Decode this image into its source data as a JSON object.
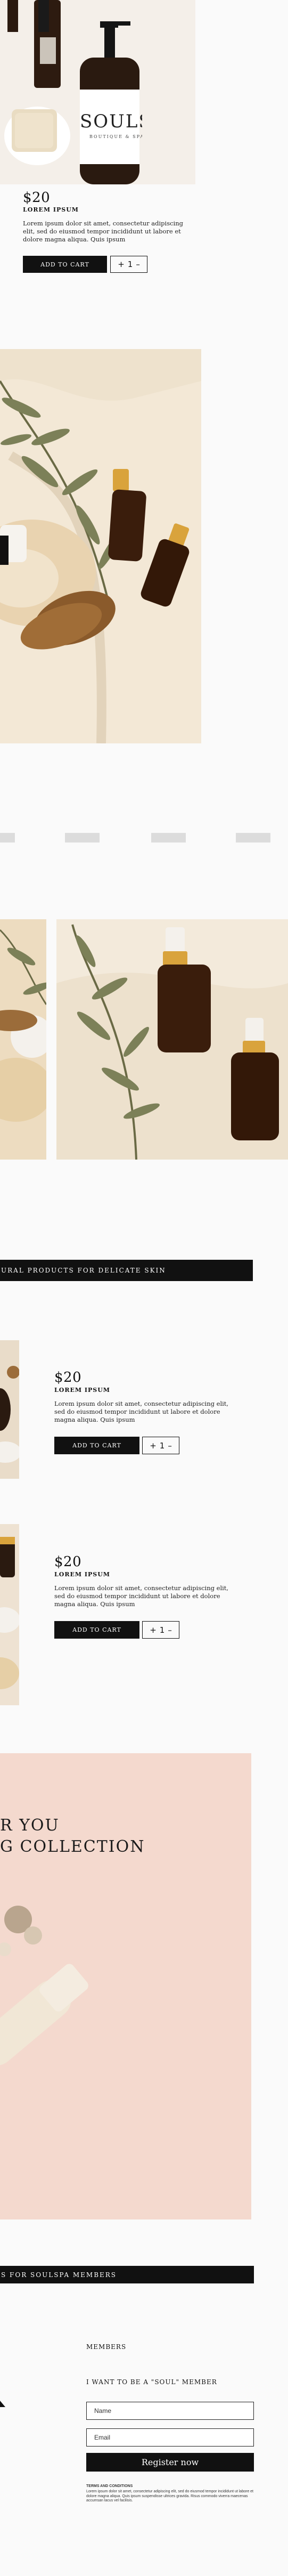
{
  "product_1": {
    "bottle_brand": "SOULSE",
    "bottle_sub": "BOUTIQUE & SPA",
    "price": "$20",
    "name": "LOREM IPSUM",
    "description": "Lorem ipsum dolor sit amet, consectetur adipiscing elit, sed do eiusmod tempor incididunt ut labore et dolore magna aliqua. Quis ipsum",
    "cart_label": "ADD TO CART",
    "qty_plus": "+",
    "qty_value": "1",
    "qty_minus": "–"
  },
  "tagline_banner": "URAL PRODUCTS FOR DELICATE SKIN",
  "product_2": {
    "price": "$20",
    "name": "LOREM IPSUM",
    "description": "Lorem ipsum dolor sit amet, consectetur adipiscing elit, sed do eiusmod tempor incididunt ut labore et dolore magna aliqua. Quis ipsum",
    "cart_label": "ADD TO CART",
    "qty_plus": "+",
    "qty_value": "1",
    "qty_minus": "–"
  },
  "product_3": {
    "price": "$20",
    "name": "LOREM IPSUM",
    "description": "Lorem ipsum dolor sit amet, consectetur adipiscing elit, sed do eiusmod tempor incididunt ut labore et dolore magna aliqua. Quis ipsum",
    "cart_label": "ADD TO CART",
    "qty_plus": "+",
    "qty_value": "1",
    "qty_minus": "–"
  },
  "collection": {
    "line1": "R YOU",
    "line2": "G COLLECTION"
  },
  "members_banner": "S FOR SOULSPA MEMBERS",
  "signup": {
    "heading": "MEMBERS",
    "subheading": "I WANT TO BE A \"SOUL\" MEMBER",
    "name_placeholder": "Name",
    "email_placeholder": "Email",
    "register_label": "Register now",
    "terms_title": "TERMS AND CONDITIONS",
    "terms_text": "Lorem ipsum dolor sit amet, consectetur adipiscing elit, sed do eiusmod tempor incididunt ut labore et dolore magna aliqua. Quis ipsum suspendisse ultrices gravida. Risus commodo viverra maecenas accumsan lacus vel facilisis."
  },
  "colors": {
    "banner_bg": "#111111",
    "cream_photo": "#efe4d3",
    "pink_photo": "#f2d2c7",
    "amber_bottle": "#3a1d0c",
    "gold_cap": "#d9a33c"
  }
}
